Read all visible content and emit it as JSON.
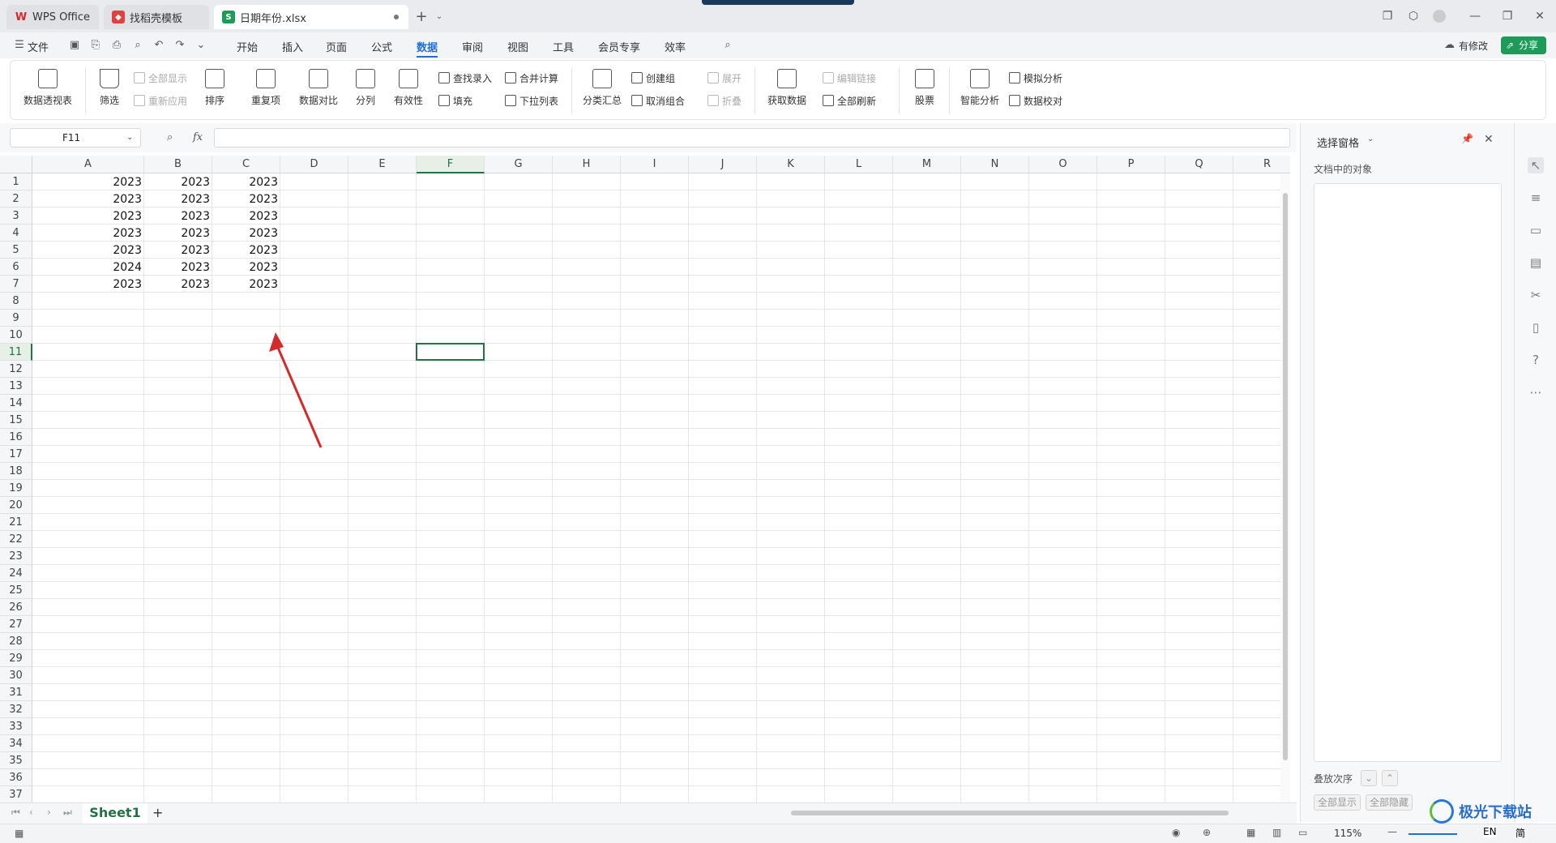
{
  "tabs": [
    {
      "label": "WPS Office",
      "icon": "wps-logo-icon"
    },
    {
      "label": "找稻壳模板",
      "icon": "docer-icon"
    },
    {
      "label": "日期年份.xlsx",
      "icon": "spreadsheet-icon"
    }
  ],
  "menu": {
    "file": "文件",
    "items": [
      "开始",
      "插入",
      "页面",
      "公式",
      "数据",
      "审阅",
      "视图",
      "工具",
      "会员专享",
      "效率"
    ],
    "active": "数据",
    "has_changes": "有修改",
    "share": "分享"
  },
  "ribbon": {
    "pivot": "数据透视表",
    "filter": "筛选",
    "show_all": "全部显示",
    "reapply": "重新应用",
    "sort": "排序",
    "duplicates": "重复项",
    "compare": "数据对比",
    "split": "分列",
    "validity": "有效性",
    "lookup": "查找录入",
    "fill": "填充",
    "consolidate": "合并计算",
    "dropdown": "下拉列表",
    "subtotal": "分类汇总",
    "group": "创建组",
    "ungroup": "取消组合",
    "expand": "展开",
    "collapse": "折叠",
    "get_data": "获取数据",
    "edit_links": "编辑链接",
    "refresh_all": "全部刷新",
    "stocks": "股票",
    "smart": "智能分析",
    "whatif": "模拟分析",
    "verify": "数据校对"
  },
  "formula_bar": {
    "name_box": "F11",
    "fx": "fx",
    "value": ""
  },
  "columns": [
    "A",
    "B",
    "C",
    "D",
    "E",
    "F",
    "G",
    "H",
    "I",
    "J",
    "K",
    "L",
    "M",
    "N",
    "O",
    "P",
    "Q",
    "R"
  ],
  "selected_col": "F",
  "selected_row": 11,
  "rows": [
    [
      "2023",
      "2023",
      "2023"
    ],
    [
      "2023",
      "2023",
      "2023"
    ],
    [
      "2023",
      "2023",
      "2023"
    ],
    [
      "2023",
      "2023",
      "2023"
    ],
    [
      "2023",
      "2023",
      "2023"
    ],
    [
      "2024",
      "2023",
      "2023"
    ],
    [
      "2023",
      "2023",
      "2023"
    ]
  ],
  "sheet": {
    "name": "Sheet1",
    "add": "+"
  },
  "status": {
    "zoom": "115%",
    "lang": "EN",
    "simp": "简"
  },
  "pane": {
    "title": "选择窗格",
    "subtitle": "文档中的对象",
    "order_label": "叠放次序",
    "show_all": "全部显示",
    "hide_all": "全部隐藏"
  },
  "watermark": "极光下载站",
  "accent": "#217346",
  "arrow_color": "#d42a2a"
}
